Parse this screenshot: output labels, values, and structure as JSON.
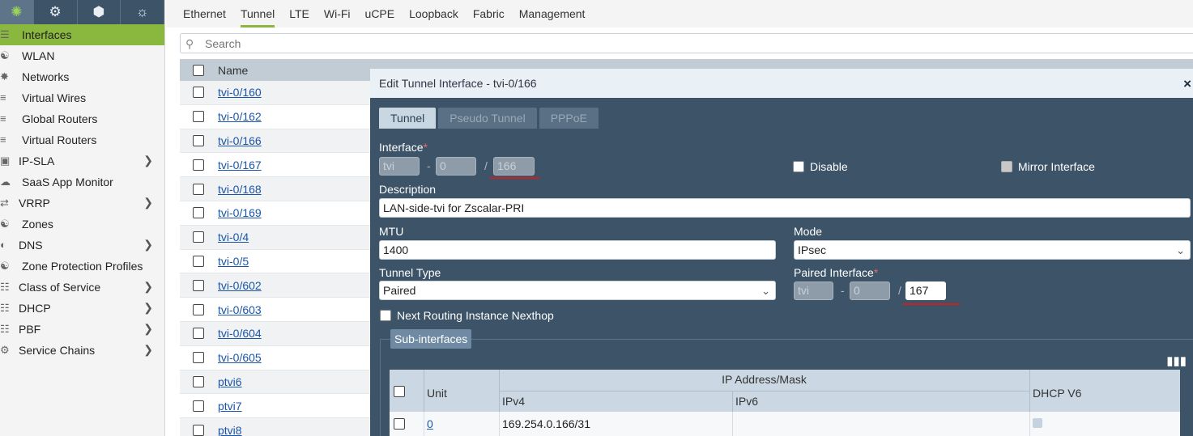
{
  "sidebar": {
    "top_icons": [
      "network-icon",
      "gear-icon",
      "cube-icon",
      "globe-gear-icon"
    ],
    "items": [
      {
        "label": "Interfaces",
        "icon": "list-icon",
        "active": true
      },
      {
        "label": "WLAN",
        "icon": "wifi-icon"
      },
      {
        "label": "Networks",
        "icon": "network-icon"
      },
      {
        "label": "Virtual Wires",
        "icon": "wire-icon"
      },
      {
        "label": "Global Routers",
        "icon": "router-icon"
      },
      {
        "label": "Virtual Routers",
        "icon": "router-icon"
      },
      {
        "label": "IP-SLA",
        "icon": "monitor-icon",
        "chevron": true
      },
      {
        "label": "SaaS App Monitor",
        "icon": "cloud-icon"
      },
      {
        "label": "VRRP",
        "icon": "vrrp-icon",
        "chevron": true
      },
      {
        "label": "Zones",
        "icon": "zone-icon"
      },
      {
        "label": "DNS",
        "icon": "dns-icon",
        "chevron": true
      },
      {
        "label": "Zone Protection Profiles",
        "icon": "shield-icon"
      },
      {
        "label": "Class of Service",
        "icon": "cos-icon",
        "chevron": true
      },
      {
        "label": "DHCP",
        "icon": "dhcp-icon",
        "chevron": true
      },
      {
        "label": "PBF",
        "icon": "pbf-icon",
        "chevron": true
      },
      {
        "label": "Service Chains",
        "icon": "gear-icon",
        "chevron": true
      }
    ]
  },
  "top_tabs": [
    "Ethernet",
    "Tunnel",
    "LTE",
    "Wi-Fi",
    "uCPE",
    "Loopback",
    "Fabric",
    "Management"
  ],
  "active_tab": "Tunnel",
  "search": {
    "placeholder": "Search"
  },
  "table": {
    "header": {
      "name": "Name"
    },
    "rows": [
      "tvi-0/160",
      "tvi-0/162",
      "tvi-0/166",
      "tvi-0/167",
      "tvi-0/168",
      "tvi-0/169",
      "tvi-0/4",
      "tvi-0/5",
      "tvi-0/602",
      "tvi-0/603",
      "tvi-0/604",
      "tvi-0/605",
      "ptvi6",
      "ptvi7",
      "ptvi8"
    ]
  },
  "modal": {
    "title": "Edit Tunnel Interface - tvi-0/166",
    "close": "×",
    "tabs": [
      "Tunnel",
      "Pseudo Tunnel",
      "PPPoE"
    ],
    "interface": {
      "label": "Interface",
      "required_mark": "*",
      "prefix": "tvi",
      "slot": "0",
      "number": "166",
      "dash": "-",
      "slash": "/"
    },
    "disable": {
      "label": "Disable",
      "checked": false
    },
    "mirror": {
      "label": "Mirror Interface",
      "checked": false
    },
    "description": {
      "label": "Description",
      "value": "LAN-side-tvi for Zscalar-PRI"
    },
    "mtu": {
      "label": "MTU",
      "value": "1400"
    },
    "mode": {
      "label": "Mode",
      "value": "IPsec"
    },
    "tunnel_type": {
      "label": "Tunnel Type",
      "value": "Paired"
    },
    "paired_interface": {
      "label": "Paired Interface",
      "required_mark": "*",
      "prefix": "tvi",
      "slot": "0",
      "number": "167",
      "dash": "-",
      "slash": "/"
    },
    "next_routing": {
      "label": "Next Routing Instance Nexthop",
      "checked": false
    },
    "sub_interfaces": {
      "button": "Sub-interfaces",
      "columns": {
        "unit": "Unit",
        "ip_group": "IP Address/Mask",
        "ipv4": "IPv4",
        "ipv6": "IPv6",
        "dhcp_v6": "DHCP V6"
      },
      "rows": [
        {
          "unit": "0",
          "ipv4": "169.254.0.166/31",
          "ipv6": ""
        }
      ]
    }
  }
}
